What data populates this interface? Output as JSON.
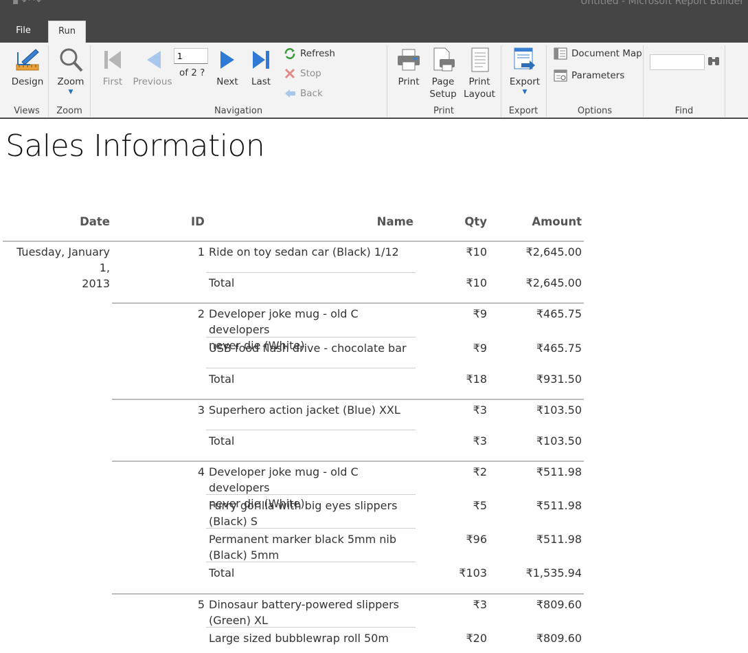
{
  "window": {
    "app_title": "Untitled - Microsoft Report Builder",
    "tabs": [
      "File",
      "Run"
    ]
  },
  "ribbon": {
    "views": {
      "design_label": "Design",
      "group": "Views"
    },
    "zoom": {
      "zoom_label": "Zoom",
      "group": "Zoom"
    },
    "navigation": {
      "first": "First",
      "previous": "Previous",
      "page_value": "1",
      "page_of": "of  2 ?",
      "next": "Next",
      "last": "Last",
      "refresh": "Refresh",
      "stop": "Stop",
      "back": "Back",
      "group": "Navigation"
    },
    "print": {
      "print": "Print",
      "page_setup_1": "Page",
      "page_setup_2": "Setup",
      "print_layout_1": "Print",
      "print_layout_2": "Layout",
      "group": "Print"
    },
    "export": {
      "export": "Export",
      "group": "Export"
    },
    "options": {
      "document_map": "Document Map",
      "parameters": "Parameters",
      "group": "Options"
    },
    "find": {
      "group": "Find",
      "value": ""
    }
  },
  "report": {
    "title": "Sales Information",
    "headers": {
      "date": "Date",
      "id": "ID",
      "name": "Name",
      "qty": "Qty",
      "amount": "Amount"
    },
    "date_line1": "Tuesday, January 1,",
    "date_line2": "2013",
    "total_label": "Total",
    "groups": [
      {
        "id": "1",
        "items": [
          {
            "name1": "Ride on toy sedan car (Black) 1/12",
            "name2": "",
            "qty": "₹10",
            "amount": "₹2,645.00"
          }
        ],
        "total_qty": "₹10",
        "total_amount": "₹2,645.00"
      },
      {
        "id": "2",
        "items": [
          {
            "name1": "Developer joke mug - old C developers",
            "name2": "never die (White)",
            "qty": "₹9",
            "amount": "₹465.75"
          },
          {
            "name1": "USB food flash drive - chocolate bar",
            "name2": "",
            "qty": "₹9",
            "amount": "₹465.75"
          }
        ],
        "total_qty": "₹18",
        "total_amount": "₹931.50"
      },
      {
        "id": "3",
        "items": [
          {
            "name1": "Superhero action jacket (Blue) XXL",
            "name2": "",
            "qty": "₹3",
            "amount": "₹103.50"
          }
        ],
        "total_qty": "₹3",
        "total_amount": "₹103.50"
      },
      {
        "id": "4",
        "items": [
          {
            "name1": "Developer joke mug - old C developers",
            "name2": "never die (White)",
            "qty": "₹2",
            "amount": "₹511.98"
          },
          {
            "name1": "Furry gorilla with big eyes slippers",
            "name2": "(Black) S",
            "qty": "₹5",
            "amount": "₹511.98"
          },
          {
            "name1": "Permanent marker black 5mm nib",
            "name2": "(Black) 5mm",
            "qty": "₹96",
            "amount": "₹511.98"
          }
        ],
        "total_qty": "₹103",
        "total_amount": "₹1,535.94"
      },
      {
        "id": "5",
        "items": [
          {
            "name1": "Dinosaur battery-powered slippers",
            "name2": "(Green) XL",
            "qty": "₹3",
            "amount": "₹809.60"
          },
          {
            "name1": "Large sized bubblewrap roll 50m",
            "name2": "",
            "qty": "₹20",
            "amount": "₹809.60"
          }
        ]
      }
    ]
  }
}
